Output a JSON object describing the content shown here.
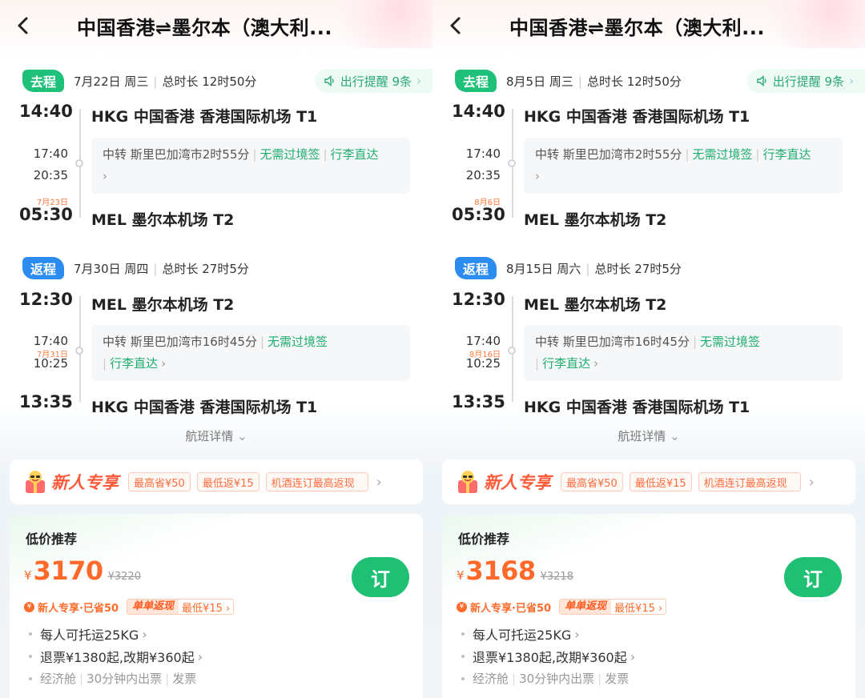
{
  "panels": [
    {
      "title": "中国香港⇌墨尔本（澳大利...",
      "outbound": {
        "tag": "去程",
        "info": "7月22日 周三",
        "duration": "总时长 12时50分",
        "reminder": "出行提醒 9条",
        "dep_time": "14:40",
        "dep_airport": "HKG 中国香港 香港国际机场 T1",
        "stop_arr": "17:40",
        "stop_dep": "20:35",
        "stop_nextday": "",
        "transfer": "中转 斯里巴加湾市2时55分",
        "tag1": "无需过境签",
        "tag2": "行李直达",
        "arr_nextday": "7月23日",
        "arr_time": "05:30",
        "arr_airport": "MEL 墨尔本机场 T2"
      },
      "inbound": {
        "tag": "返程",
        "info": "7月30日 周四",
        "duration": "总时长 27时5分",
        "dep_time": "12:30",
        "dep_airport": "MEL 墨尔本机场 T2",
        "stop_arr": "17:40",
        "stop_nextday": "7月31日",
        "stop_dep": "10:25",
        "transfer": "中转 斯里巴加湾市16时45分",
        "tag1": "无需过境签",
        "tag2": "行李直达",
        "arr_time": "13:35",
        "arr_airport": "HKG 中国香港 香港国际机场 T1"
      },
      "details": "航班详情",
      "promo": {
        "title": "新人专享",
        "chip1": "最高省¥50",
        "chip2": "最低返¥15",
        "chip3": "机酒连订最高返现"
      },
      "card": {
        "title": "低价推荐",
        "currency": "¥",
        "price": "3170",
        "orig_price": "¥3220",
        "book": "订",
        "benefit1": "新人专享·已省50",
        "benefit_highlight": "单单返现",
        "benefit2": "最低¥15",
        "feature1": "每人可托运25KG",
        "feature2": "退票¥1380起,改期¥360起",
        "feature3a": "经济舱",
        "feature3b": "30分钟内出票",
        "feature3c": "发票"
      }
    },
    {
      "title": "中国香港⇌墨尔本（澳大利...",
      "outbound": {
        "tag": "去程",
        "info": "8月5日 周三",
        "duration": "总时长 12时50分",
        "reminder": "出行提醒 9条",
        "dep_time": "14:40",
        "dep_airport": "HKG 中国香港 香港国际机场 T1",
        "stop_arr": "17:40",
        "stop_dep": "20:35",
        "stop_nextday": "",
        "transfer": "中转 斯里巴加湾市2时55分",
        "tag1": "无需过境签",
        "tag2": "行李直达",
        "arr_nextday": "8月6日",
        "arr_time": "05:30",
        "arr_airport": "MEL 墨尔本机场 T2"
      },
      "inbound": {
        "tag": "返程",
        "info": "8月15日 周六",
        "duration": "总时长 27时5分",
        "dep_time": "12:30",
        "dep_airport": "MEL 墨尔本机场 T2",
        "stop_arr": "17:40",
        "stop_nextday": "8月16日",
        "stop_dep": "10:25",
        "transfer": "中转 斯里巴加湾市16时45分",
        "tag1": "无需过境签",
        "tag2": "行李直达",
        "arr_time": "13:35",
        "arr_airport": "HKG 中国香港 香港国际机场 T1"
      },
      "details": "航班详情",
      "promo": {
        "title": "新人专享",
        "chip1": "最高省¥50",
        "chip2": "最低返¥15",
        "chip3": "机酒连订最高返现"
      },
      "card": {
        "title": "低价推荐",
        "currency": "¥",
        "price": "3168",
        "orig_price": "¥3218",
        "book": "订",
        "benefit1": "新人专享·已省50",
        "benefit_highlight": "单单返现",
        "benefit2": "最低¥15",
        "feature1": "每人可托运25KG",
        "feature2": "退票¥1380起,改期¥360起",
        "feature3a": "经济舱",
        "feature3b": "30分钟内出票",
        "feature3c": "发票"
      }
    }
  ],
  "icons": {
    "back": "chevron-left-icon",
    "speaker": "speaker-icon",
    "gift": "gift-mascot-icon"
  },
  "colors": {
    "green": "#1fc07a",
    "blue": "#2d8cf0",
    "orange": "#ff6a2b"
  }
}
